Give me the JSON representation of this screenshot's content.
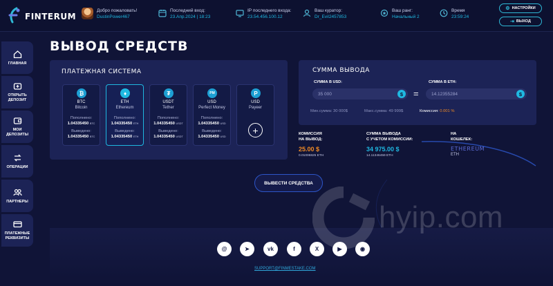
{
  "brand": {
    "name": "FINTERUM"
  },
  "header": {
    "welcome": {
      "label": "Добро пожаловать!",
      "value": "DustinPower467"
    },
    "last_login": {
      "label": "Последний вход:",
      "value": "23.Апр.2024 | 18:23"
    },
    "ip": {
      "label": "IP последнего входа:",
      "value": "23.54.456.100.12"
    },
    "curator": {
      "label": "Ваш куратор:",
      "value": "Dr_Evil2457853"
    },
    "rank": {
      "label": "Ваш ранг:",
      "value": "Начальный 2"
    },
    "time": {
      "label": "Время",
      "value": "23:59:24"
    },
    "settings_button": "НАСТРОЙКИ",
    "logout_button": "ВЫХОД"
  },
  "sidebar": {
    "items": [
      {
        "label": "ГЛАВНАЯ",
        "icon": "home-icon"
      },
      {
        "label": "ОТКРЫТЬ ДЕПОЗИТ",
        "icon": "deposit-icon"
      },
      {
        "label": "МОИ ДЕПОЗИТЫ",
        "icon": "wallet-icon"
      },
      {
        "label": "ОПЕРАЦИИ",
        "icon": "operations-icon"
      },
      {
        "label": "ПАРТНЕРЫ",
        "icon": "partners-icon"
      },
      {
        "label": "ПЛАТЕЖНЫЕ РЕКВИЗИТЫ",
        "icon": "card-icon"
      }
    ]
  },
  "page": {
    "title": "ВЫВОД СРЕДСТВ"
  },
  "payment": {
    "title": "ПЛАТЕЖНАЯ СИСТЕМА",
    "deposited_label": "Пополнено:",
    "withdrawn_label": "Выведено:",
    "cards": [
      {
        "code": "BTC",
        "name": "Bitcoin",
        "deposited": "1.04335450",
        "deposited_cur": "BTC",
        "withdrawn": "1.04335450",
        "withdrawn_cur": "BTC",
        "icon": "bitcoin-icon",
        "glyph": "₿",
        "selected": false
      },
      {
        "code": "ETH",
        "name": "Ethereum",
        "deposited": "1.04335450",
        "deposited_cur": "ETH",
        "withdrawn": "1.04335450",
        "withdrawn_cur": "ETH",
        "icon": "ethereum-icon",
        "glyph": "♦",
        "selected": true
      },
      {
        "code": "USDT",
        "name": "Tether",
        "deposited": "1.04335450",
        "deposited_cur": "USDT",
        "withdrawn": "1.04335450",
        "withdrawn_cur": "USDT",
        "icon": "tether-icon",
        "glyph": "₮",
        "selected": false
      },
      {
        "code": "USD",
        "name": "Perfect Money",
        "deposited": "1.04335450",
        "deposited_cur": "USD",
        "withdrawn": "1.04335450",
        "withdrawn_cur": "USD",
        "icon": "perfect-money-icon",
        "glyph": "PM",
        "selected": false
      },
      {
        "code": "USD",
        "name": "Payeer",
        "icon": "payeer-icon",
        "glyph": "P",
        "selected": false
      }
    ]
  },
  "withdraw_sum": {
    "title": "СУММА ВЫВОДА",
    "usd_label": "СУММА В USD:",
    "usd_value": "35 000",
    "eth_label": "СУММА В ETH:",
    "eth_value": "14.12355284",
    "min_sum": "Мин.сумма: 30 000$",
    "max_sum": "Макс.сумма: 49 999$",
    "commission_label": "Комиссия:",
    "commission_value": "0.001 %"
  },
  "summary": {
    "commission_label_1": "КОМИССИЯ",
    "commission_label_2": "НА ВЫВОД:",
    "commission_usd": "25.00 $",
    "commission_eth": "0.01006825 ETH",
    "total_label_1": "СУММА ВЫВОДА",
    "total_label_2": "С УЧЕТОМ КОМИССИИ:",
    "total_usd": "34 975.00 $",
    "total_eth": "14.11346459 ETH",
    "wallet_label_1": "НА",
    "wallet_label_2": "КОШЕЛЕК:",
    "wallet_logo": "ETHEREUM",
    "wallet_code": "ETH"
  },
  "actions": {
    "withdraw_button": "ВЫВЕСТИ СРЕДСТВА"
  },
  "footer": {
    "support_email": "SUPPORT@FINMESTAKE.COM",
    "socials": [
      {
        "icon": "email-icon",
        "glyph": "@"
      },
      {
        "icon": "telegram-icon",
        "glyph": "➤"
      },
      {
        "icon": "vk-icon",
        "glyph": "vk"
      },
      {
        "icon": "facebook-icon",
        "glyph": "f"
      },
      {
        "icon": "x-icon",
        "glyph": "X"
      },
      {
        "icon": "youtube-icon",
        "glyph": "▶"
      },
      {
        "icon": "discord-icon",
        "glyph": "◉"
      }
    ]
  },
  "watermark": {
    "text": "hyip.com"
  },
  "colors": {
    "background": "#101437",
    "panel": "#1c2356",
    "accent_cyan": "#1fb8e1",
    "accent_orange": "#f08a24",
    "accent_blue": "#2d56c9"
  }
}
